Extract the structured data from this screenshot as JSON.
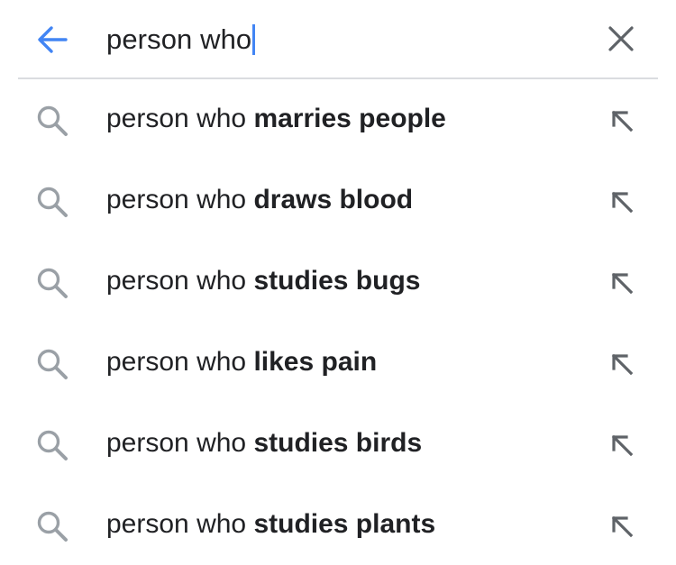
{
  "search": {
    "query": "person who",
    "caret_color": "#4285f4"
  },
  "colors": {
    "accent": "#4285f4",
    "text": "#202124",
    "icon_gray": "#9aa0a6",
    "divider": "#dadce0"
  },
  "icons": {
    "back": "arrow-left-icon",
    "clear": "close-icon",
    "suggestion": "search-icon",
    "fill": "arrow-up-left-icon"
  },
  "suggestions": [
    {
      "prefix": "person who ",
      "completion": "marries people"
    },
    {
      "prefix": "person who ",
      "completion": "draws blood"
    },
    {
      "prefix": "person who ",
      "completion": "studies bugs"
    },
    {
      "prefix": "person who ",
      "completion": "likes pain"
    },
    {
      "prefix": "person who ",
      "completion": "studies birds"
    },
    {
      "prefix": "person who ",
      "completion": "studies plants"
    }
  ]
}
